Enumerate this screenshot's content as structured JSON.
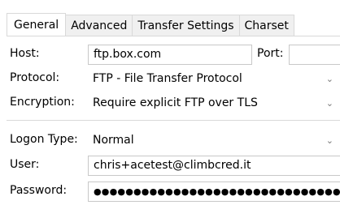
{
  "tabs": [
    {
      "label": "General",
      "active": true
    },
    {
      "label": "Advanced",
      "active": false
    },
    {
      "label": "Transfer Settings",
      "active": false
    },
    {
      "label": "Charset",
      "active": false
    }
  ],
  "host": {
    "label": "Host:",
    "value": "ftp.box.com",
    "port_label": "Port:",
    "port_value": ""
  },
  "protocol": {
    "label": "Protocol:",
    "value": "FTP - File Transfer Protocol"
  },
  "encryption": {
    "label": "Encryption:",
    "value": "Require explicit FTP over TLS"
  },
  "logon_type": {
    "label": "Logon Type:",
    "value": "Normal"
  },
  "user": {
    "label": "User:",
    "value": "chris+acetest@climbcred.it"
  },
  "password": {
    "label": "Password:",
    "value": "●●●●●●●●●●●●●●●●●●●●●●●●●●●●●●●●"
  },
  "icons": {
    "dropdown": "chevron-down-icon"
  }
}
